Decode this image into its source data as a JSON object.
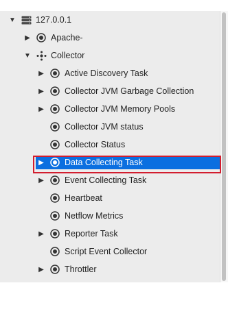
{
  "tree": {
    "root": {
      "label": "127.0.0.1",
      "icon": "server-icon",
      "expanded": true
    },
    "apache": {
      "label": "Apache-",
      "icon": "target-icon",
      "expanded": false
    },
    "collector": {
      "label": "Collector",
      "icon": "cluster-icon",
      "expanded": true,
      "children": [
        {
          "label": "Active Discovery Task",
          "icon": "target-icon",
          "expandable": true
        },
        {
          "label": "Collector JVM Garbage Collection",
          "icon": "target-icon",
          "expandable": true
        },
        {
          "label": "Collector JVM Memory Pools",
          "icon": "target-icon",
          "expandable": true
        },
        {
          "label": "Collector JVM status",
          "icon": "target-icon",
          "expandable": false
        },
        {
          "label": "Collector Status",
          "icon": "target-icon",
          "expandable": false
        },
        {
          "label": "Data Collecting Task",
          "icon": "target-icon",
          "expandable": true,
          "selected": true
        },
        {
          "label": "Event Collecting Task",
          "icon": "target-icon",
          "expandable": true
        },
        {
          "label": "Heartbeat",
          "icon": "target-icon",
          "expandable": false
        },
        {
          "label": "Netflow Metrics",
          "icon": "target-icon",
          "expandable": false
        },
        {
          "label": "Reporter Task",
          "icon": "target-icon",
          "expandable": true
        },
        {
          "label": "Script Event Collector",
          "icon": "target-icon",
          "expandable": false
        },
        {
          "label": "Throttler",
          "icon": "target-icon",
          "expandable": true
        }
      ]
    }
  },
  "colors": {
    "panel_background": "#ececec",
    "selection": "#0b6fe0",
    "highlight_border": "#d21d2e",
    "icon": "#333333"
  }
}
